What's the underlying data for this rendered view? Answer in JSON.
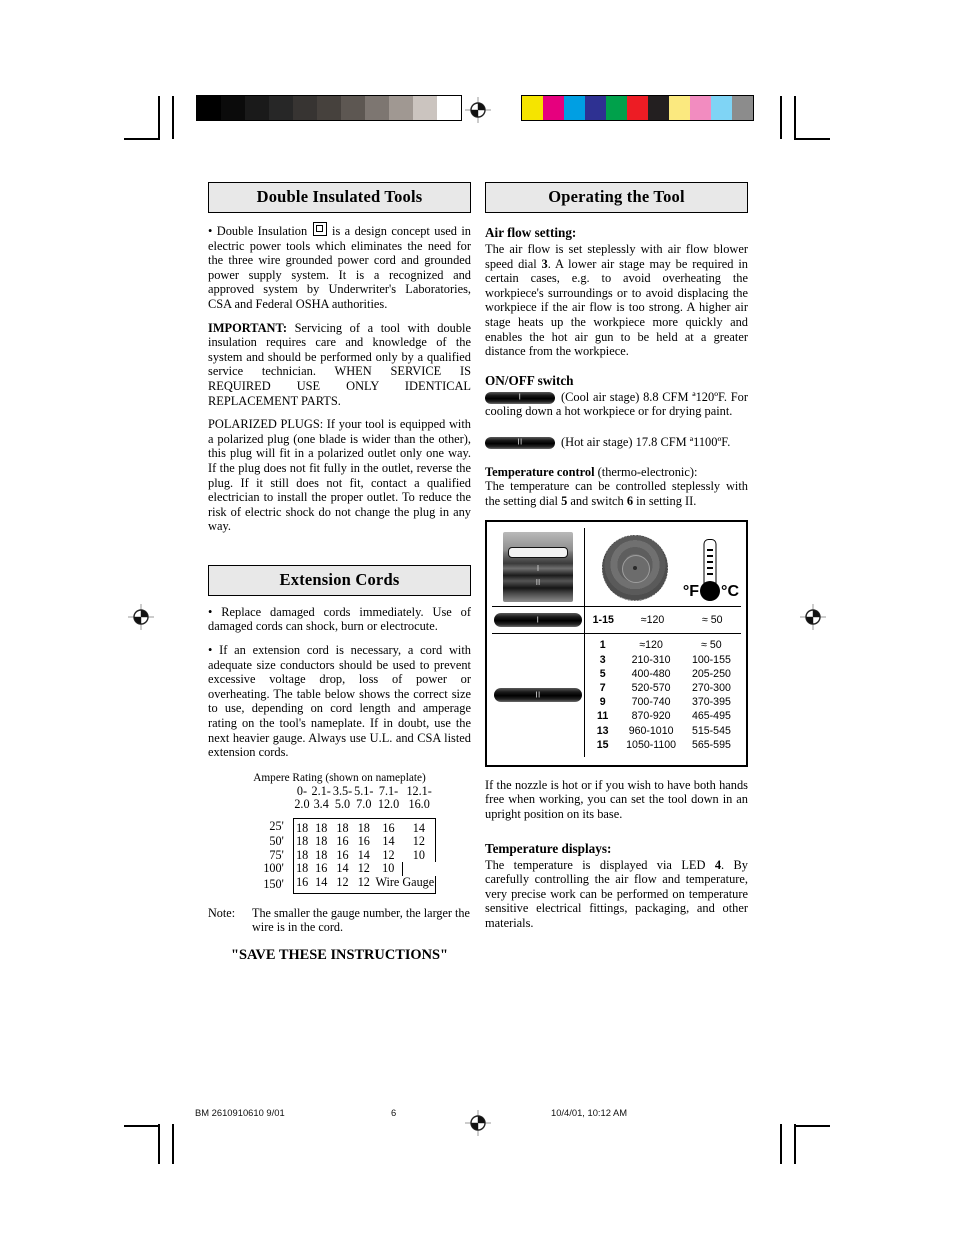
{
  "page": {
    "number": "6",
    "footer_left": "BM 2610910610 9/01",
    "footer_right": "10/4/01, 10:12 AM"
  },
  "calibration": {
    "gray_steps": [
      "#000000",
      "#0b0b0b",
      "#1a1a1a",
      "#272727",
      "#373432",
      "#46413d",
      "#5d5752",
      "#7d7671",
      "#a09892",
      "#cbc4bf",
      "#ffffff"
    ],
    "color_steps": [
      "#f5e400",
      "#e6007e",
      "#009fe3",
      "#2e3192",
      "#00a14b",
      "#ed1c24",
      "#231f20",
      "#fbe97f",
      "#f28cc0",
      "#7fd4f5",
      "#8c8c8c"
    ]
  },
  "left_column": {
    "section1": {
      "heading": "Double Insulated Tools",
      "bullet_prefix": "•  Double Insulation ",
      "icon_name": "double-insulation-symbol",
      "bullet_suffix": " is a design concept used in electric power tools which eliminates the need for the three wire grounded power cord and grounded power supply system. It is a recognized and approved system by Underwriter's Laboratories, CSA and Federal OSHA authorities.",
      "important_label": "IMPORTANT:",
      "important_text": " Servicing of a tool with double insulation requires care and knowledge of the system and should be performed only by a qualified service technician.  WHEN SERVICE IS REQUIRED USE ONLY IDENTICAL REPLACEMENT PARTS.",
      "polarized_text": "POLARIZED PLUGS: If your tool is equipped with a polarized plug (one blade is wider than the other), this plug will fit in a polarized outlet only one way.  If the plug does not fit fully in the outlet, reverse the plug.  If it still does not fit, contact a qualified electrician to install the proper outlet.  To reduce the risk of electric shock do not change the plug in any way."
    },
    "section2": {
      "heading": "Extension Cords",
      "para1": "•  Replace damaged cords immediately. Use of damaged cords can shock, burn or electrocute.",
      "para2": "•  If an extension cord is necessary, a cord with adequate size conductors should be used to prevent excessive voltage drop, loss of power or overheating.   The table below shows the correct size to use, depending on cord length and amperage rating on the tool's nameplate.  If in doubt, use the next heavier gauge. Always use U.L. and CSA listed extension cords.",
      "table": {
        "caption": "Ampere Rating (shown on nameplate)",
        "col_headers_top": [
          "0-",
          "2.1-",
          "3.5-",
          "5.1-",
          "7.1-",
          "12.1-"
        ],
        "col_headers_bottom": [
          "2.0",
          "3.4",
          "5.0",
          "7.0",
          "12.0",
          "16.0"
        ],
        "row_labels": [
          "25'",
          "50'",
          "75'",
          "100'",
          "150'"
        ],
        "rows": [
          [
            "18",
            "18",
            "18",
            "18",
            "16",
            "14"
          ],
          [
            "18",
            "18",
            "16",
            "16",
            "14",
            "12"
          ],
          [
            "18",
            "18",
            "16",
            "14",
            "12",
            "10"
          ],
          [
            "18",
            "16",
            "14",
            "12",
            "10",
            ""
          ],
          [
            "16",
            "14",
            "12",
            "12",
            "Wire Gauge",
            ""
          ]
        ]
      },
      "note_label": "Note:",
      "note_text": "The smaller the gauge number, the larger the wire is in the cord.",
      "save_instructions": "\"SAVE THESE INSTRUCTIONS\""
    }
  },
  "right_column": {
    "heading": "Operating the Tool",
    "air_flow": {
      "head": "Air flow setting:",
      "text_a": "The air flow is set steplessly with air flow blower speed dial ",
      "ref_a": "3",
      "text_b": ". A lower air stage may be required in certain cases, e.g. to avoid overheating the workpiece's surroundings or to avoid displacing the workpiece if the air flow is too strong. A higher air stage heats up the workpiece more quickly and enables the hot air gun to be held at a greater distance from the workpiece."
    },
    "onoff": {
      "head": "ON/OFF switch",
      "stage1_icon": "switch-stage-one-icon",
      "stage1_mark": "I",
      "stage1_text": "(Cool air stage) 8.8 CFM ª120ºF.",
      "stage1_follow": "For cooling down a hot workpiece or for drying paint.",
      "stage2_icon": "switch-stage-two-icon",
      "stage2_mark": "II",
      "stage2_text": "(Hot air stage) 17.8 CFM ª1100ºF."
    },
    "temp_control": {
      "head": "Temperature control",
      "head_suffix": " (thermo-electronic):",
      "text_a": "The temperature can be controlled steplessly with the setting dial ",
      "ref_a": "5",
      "text_b": " and switch ",
      "ref_b": "6",
      "text_c": " in setting II."
    },
    "temp_figure": {
      "icon_switch3": "three-position-switch-icon",
      "icon_dial": "rotary-dial-icon",
      "icon_thermometer": "thermometer-icon",
      "unit_f": "°F",
      "unit_c": "°C",
      "row_stage1": {
        "icon_mark": "I",
        "setting": "1-15",
        "f": "≈120",
        "c": "≈ 50"
      },
      "row_stage2_icon_mark": "II",
      "rows_stage2": [
        {
          "setting": "1",
          "f": "≈120",
          "c": "≈ 50"
        },
        {
          "setting": "3",
          "f": "210-310",
          "c": "100-155"
        },
        {
          "setting": "5",
          "f": "400-480",
          "c": "205-250"
        },
        {
          "setting": "7",
          "f": "520-570",
          "c": "270-300"
        },
        {
          "setting": "9",
          "f": "700-740",
          "c": "370-395"
        },
        {
          "setting": "11",
          "f": "870-920",
          "c": "465-495"
        },
        {
          "setting": "13",
          "f": "960-1010",
          "c": "515-545"
        },
        {
          "setting": "15",
          "f": "1050-1100",
          "c": "565-595"
        }
      ]
    },
    "nozzle_text": "If the nozzle is hot or if you wish to have both hands free when working, you can set the tool down in an upright position on its base.",
    "temp_displays": {
      "head": "Temperature displays:",
      "text_a": "The temperature is displayed via LED ",
      "ref_a": "4",
      "text_b": ". By carefully controlling the air flow and temperature, very precise work can be performed on temperature sensitive electrical fittings, packaging, and other materials."
    }
  }
}
